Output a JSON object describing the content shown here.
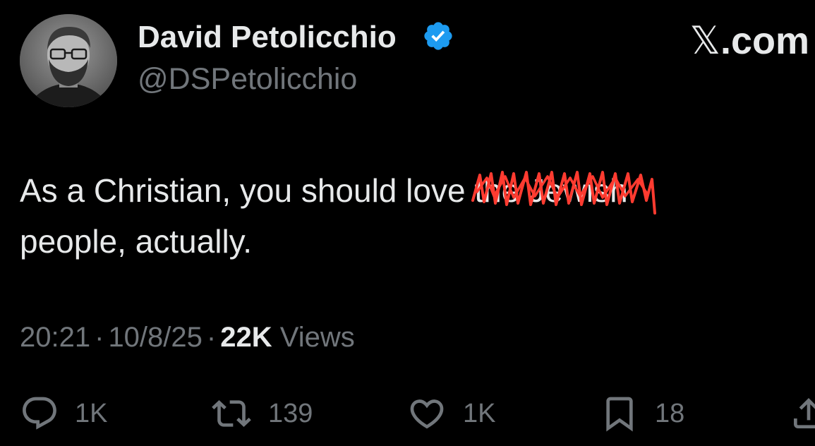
{
  "author": {
    "display_name": "David Petolicchio",
    "handle": "@DSPetolicchio",
    "verified": true,
    "verified_color": "#1d9bf0"
  },
  "site_logo": {
    "glyph": "𝕏",
    "suffix": ".com"
  },
  "tweet": {
    "text_before": "As a Christian, you should love ",
    "redacted_text": "the Jewish",
    "text_line2": "people, actually.",
    "redaction_color": "#ff3b30"
  },
  "meta": {
    "time": "20:21",
    "separator": "·",
    "date": "10/8/25",
    "views_count": "22K",
    "views_label": "Views"
  },
  "actions": {
    "reply": {
      "icon": "reply-icon",
      "count": "1K"
    },
    "retweet": {
      "icon": "retweet-icon",
      "count": "139"
    },
    "like": {
      "icon": "heart-icon",
      "count": "1K"
    },
    "bookmark": {
      "icon": "bookmark-icon",
      "count": "18"
    },
    "share": {
      "icon": "share-icon"
    }
  },
  "colors": {
    "background": "#000000",
    "primary_text": "#e7e9ea",
    "secondary_text": "#71767b"
  }
}
